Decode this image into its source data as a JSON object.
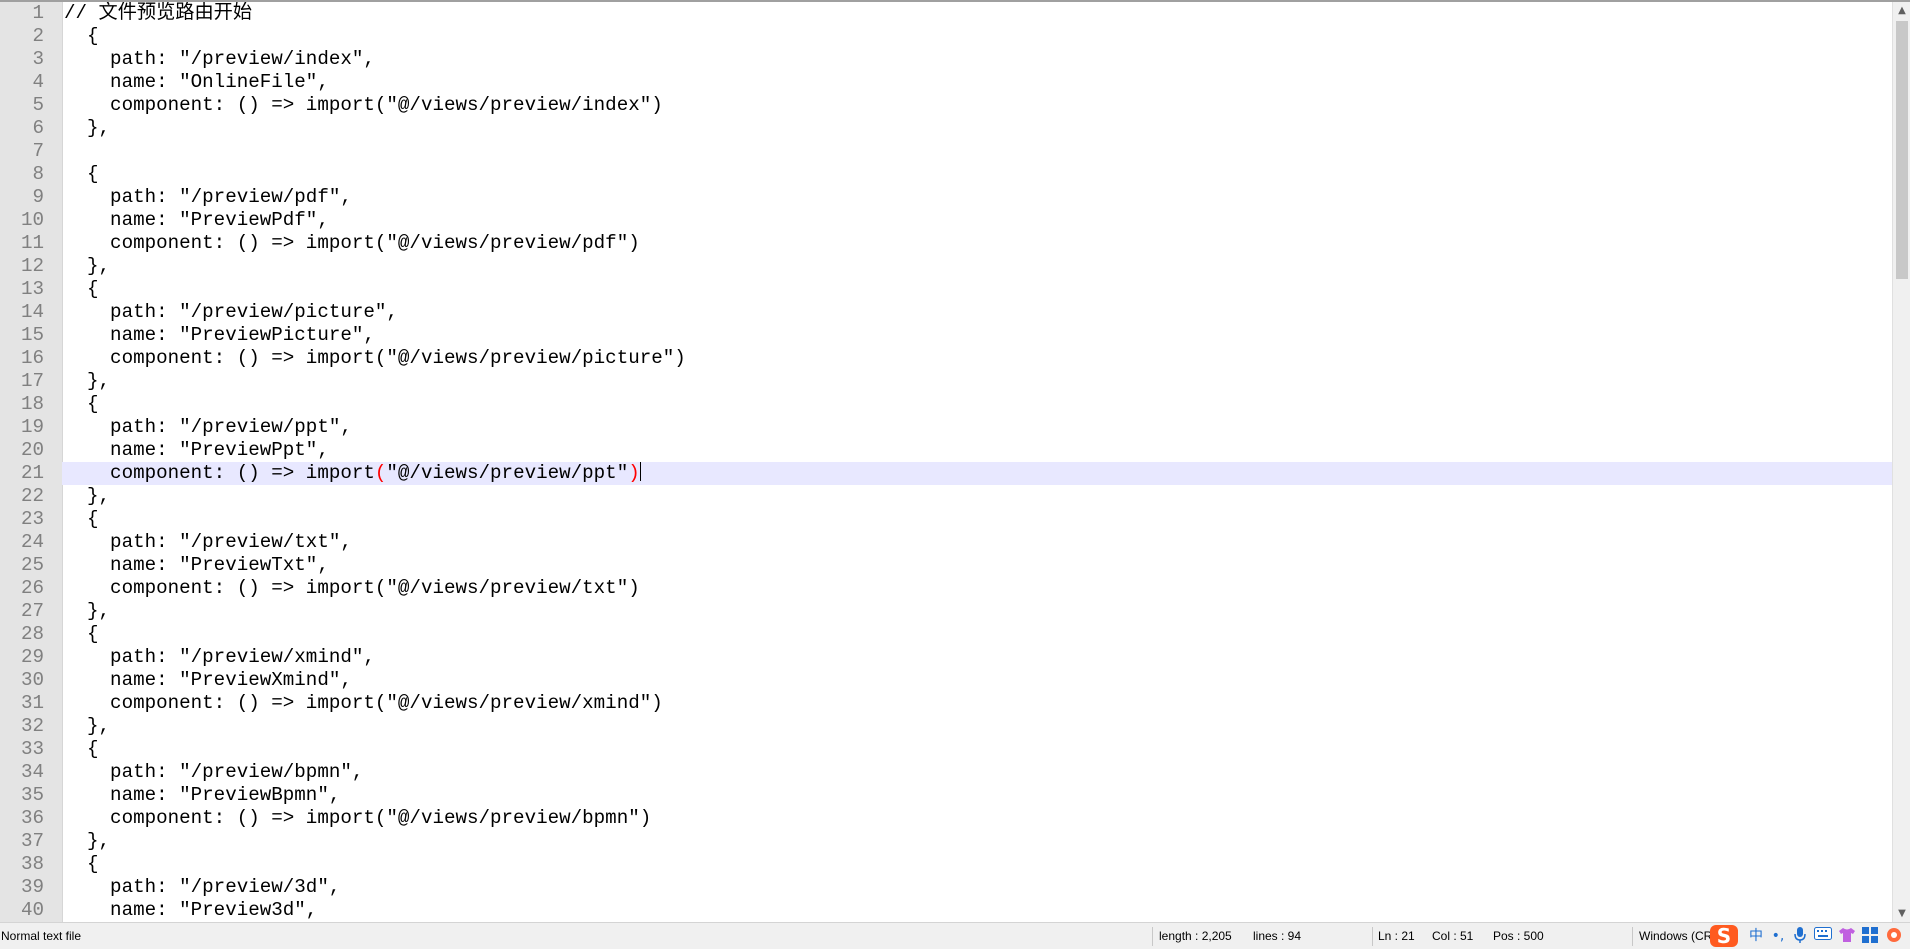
{
  "editor": {
    "lines": [
      {
        "number": "1",
        "text": "// 文件预览路由开始"
      },
      {
        "number": "2",
        "text": "  {"
      },
      {
        "number": "3",
        "text": "    path: \"/preview/index\","
      },
      {
        "number": "4",
        "text": "    name: \"OnlineFile\","
      },
      {
        "number": "5",
        "text": "    component: () => import(\"@/views/preview/index\")"
      },
      {
        "number": "6",
        "text": "  },"
      },
      {
        "number": "7",
        "text": ""
      },
      {
        "number": "8",
        "text": "  {"
      },
      {
        "number": "9",
        "text": "    path: \"/preview/pdf\","
      },
      {
        "number": "10",
        "text": "    name: \"PreviewPdf\","
      },
      {
        "number": "11",
        "text": "    component: () => import(\"@/views/preview/pdf\")"
      },
      {
        "number": "12",
        "text": "  },"
      },
      {
        "number": "13",
        "text": "  {"
      },
      {
        "number": "14",
        "text": "    path: \"/preview/picture\","
      },
      {
        "number": "15",
        "text": "    name: \"PreviewPicture\","
      },
      {
        "number": "16",
        "text": "    component: () => import(\"@/views/preview/picture\")"
      },
      {
        "number": "17",
        "text": "  },"
      },
      {
        "number": "18",
        "text": "  {"
      },
      {
        "number": "19",
        "text": "    path: \"/preview/ppt\","
      },
      {
        "number": "20",
        "text": "    name: \"PreviewPpt\","
      },
      {
        "number": "21",
        "text": "    component: () => import(\"@/views/preview/ppt\")"
      },
      {
        "number": "22",
        "text": "  },"
      },
      {
        "number": "23",
        "text": "  {"
      },
      {
        "number": "24",
        "text": "    path: \"/preview/txt\","
      },
      {
        "number": "25",
        "text": "    name: \"PreviewTxt\","
      },
      {
        "number": "26",
        "text": "    component: () => import(\"@/views/preview/txt\")"
      },
      {
        "number": "27",
        "text": "  },"
      },
      {
        "number": "28",
        "text": "  {"
      },
      {
        "number": "29",
        "text": "    path: \"/preview/xmind\","
      },
      {
        "number": "30",
        "text": "    name: \"PreviewXmind\","
      },
      {
        "number": "31",
        "text": "    component: () => import(\"@/views/preview/xmind\")"
      },
      {
        "number": "32",
        "text": "  },"
      },
      {
        "number": "33",
        "text": "  {"
      },
      {
        "number": "34",
        "text": "    path: \"/preview/bpmn\","
      },
      {
        "number": "35",
        "text": "    name: \"PreviewBpmn\","
      },
      {
        "number": "36",
        "text": "    component: () => import(\"@/views/preview/bpmn\")"
      },
      {
        "number": "37",
        "text": "  },"
      },
      {
        "number": "38",
        "text": "  {"
      },
      {
        "number": "39",
        "text": "    path: \"/preview/3d\","
      },
      {
        "number": "40",
        "text": "    name: \"Preview3d\","
      }
    ],
    "current_line": {
      "number": "21",
      "before": "    component: () => import",
      "open_paren": "(",
      "middle": "\"@/views/preview/ppt\"",
      "close_paren": ")"
    },
    "colors": {
      "gutter": "#e4e4e4",
      "line_number": "#808080",
      "current_line": "#e8e8ff",
      "brace_highlight": "#ff0000"
    }
  },
  "statusbar": {
    "file_type": "Normal text file",
    "length": "length : 2,205",
    "lines": "lines : 94",
    "ln": "Ln : 21",
    "col": "Col : 51",
    "pos": "Pos : 500",
    "eol": "Windows (CR"
  },
  "tray": {
    "ime_logo": "S",
    "ime_mode": "中",
    "punctuation": "•,",
    "mic": "🎤",
    "keyboard": "⌨",
    "skin": "👕",
    "toolbox": "⊞",
    "extra": "◉",
    "icons": [
      "sogou-logo-icon",
      "chinese-mode-icon",
      "punctuation-icon",
      "microphone-icon",
      "keyboard-icon",
      "skin-icon",
      "toolbox-icon",
      "extra-icon"
    ]
  }
}
